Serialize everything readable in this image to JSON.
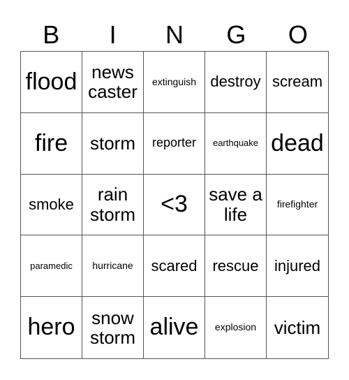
{
  "header": [
    "B",
    "I",
    "N",
    "G",
    "O"
  ],
  "cells": [
    {
      "text": "flood",
      "size": "xl"
    },
    {
      "text": "news caster",
      "size": "l"
    },
    {
      "text": "extinguish",
      "size": "xs"
    },
    {
      "text": "destroy",
      "size": "m"
    },
    {
      "text": "scream",
      "size": "m"
    },
    {
      "text": "fire",
      "size": "xl"
    },
    {
      "text": "storm",
      "size": "l"
    },
    {
      "text": "reporter",
      "size": "s"
    },
    {
      "text": "earthquake",
      "size": "xxs"
    },
    {
      "text": "dead",
      "size": "xl"
    },
    {
      "text": "smoke",
      "size": "m"
    },
    {
      "text": "rain storm",
      "size": "l"
    },
    {
      "text": "<3",
      "size": "xl"
    },
    {
      "text": "save a life",
      "size": "l"
    },
    {
      "text": "firefighter",
      "size": "xs"
    },
    {
      "text": "paramedic",
      "size": "xxs"
    },
    {
      "text": "hurricane",
      "size": "xs"
    },
    {
      "text": "scared",
      "size": "m"
    },
    {
      "text": "rescue",
      "size": "m"
    },
    {
      "text": "injured",
      "size": "m"
    },
    {
      "text": "hero",
      "size": "xl"
    },
    {
      "text": "snow storm",
      "size": "l"
    },
    {
      "text": "alive",
      "size": "xl"
    },
    {
      "text": "explosion",
      "size": "xs"
    },
    {
      "text": "victim",
      "size": "l"
    }
  ]
}
